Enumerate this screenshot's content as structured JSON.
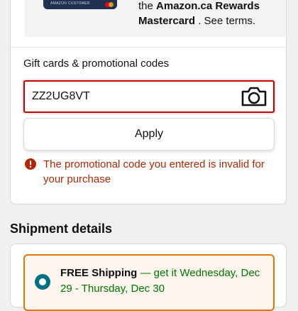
{
  "promo": {
    "card_text": "AMAZON CUSTOMER",
    "line1_prefix": "the",
    "line1_bold": "Amazon.ca Rewards",
    "line2_bold": "Mastercard",
    "line2_suffix": " . See terms."
  },
  "gift": {
    "heading": "Gift cards & promotional codes",
    "code_value": "ZZ2UG8VT",
    "apply_label": "Apply",
    "error_message": "The promotional code you entered is invalid for your purchase"
  },
  "shipment": {
    "title": "Shipment details",
    "option_label": "FREE Shipping",
    "option_date": " — get it Wednesday, Dec 29 - Thursday, Dec 30"
  },
  "colors": {
    "error": "#b12704",
    "error_border": "#c40000",
    "delivery_green": "#007600",
    "selected_border": "#e77600",
    "radio": "#007185"
  }
}
